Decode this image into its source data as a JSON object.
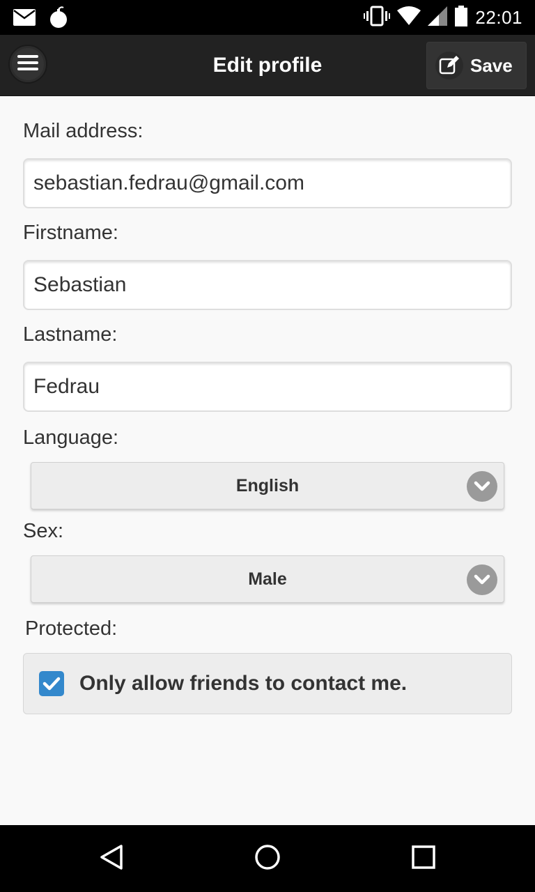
{
  "status_bar": {
    "time": "22:01",
    "left_icons": [
      "mail-icon",
      "bomb-icon"
    ],
    "right_icons": [
      "vibrate-icon",
      "wifi-icon",
      "signal-icon",
      "battery-icon"
    ]
  },
  "header": {
    "title": "Edit profile",
    "menu_icon": "hamburger-icon",
    "save_label": "Save",
    "save_icon": "edit-icon"
  },
  "form": {
    "mail": {
      "label": "Mail address:",
      "value": "sebastian.fedrau@gmail.com"
    },
    "firstname": {
      "label": "Firstname:",
      "value": "Sebastian"
    },
    "lastname": {
      "label": "Lastname:",
      "value": "Fedrau"
    },
    "language": {
      "label": "Language:",
      "selected": "English"
    },
    "sex": {
      "label": "Sex:",
      "selected": "Male"
    },
    "protected": {
      "label": "Protected:",
      "checkbox_label": "Only allow friends to contact me.",
      "checked": true
    }
  },
  "nav_bar": {
    "icons": [
      "back-icon",
      "home-icon",
      "recents-icon"
    ]
  },
  "colors": {
    "header_bg": "#222222",
    "accent": "#3388cc",
    "page_bg": "#f9f9f9"
  }
}
